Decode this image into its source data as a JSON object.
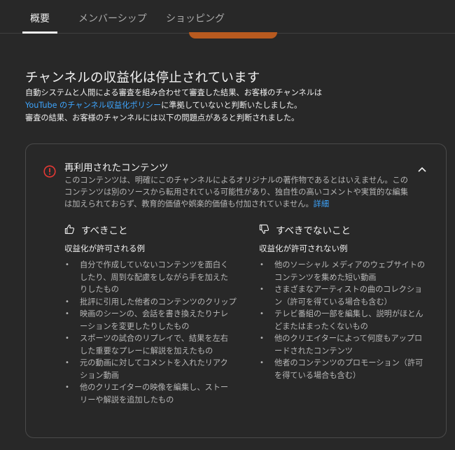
{
  "tabs": [
    {
      "label": "概要",
      "active": true
    },
    {
      "label": "メンバーシップ",
      "active": false
    },
    {
      "label": "ショッピング",
      "active": false
    }
  ],
  "heading": "チャンネルの収益化は停止されています",
  "intro": {
    "line1": "自動システムと人間による審査を組み合わせて審査した結果、お客様のチャンネルは",
    "policy_link": "YouTube のチャンネル収益化ポリシー",
    "line2_rest": "に準拠していないと判断いたしました。",
    "line3": "審査の結果、お客様のチャンネルには以下の問題点があると判断されました。"
  },
  "issue": {
    "title": "再利用されたコンテンツ",
    "desc_lines": [
      "このコンテンツは、明確にこのチャンネルによるオリジナルの著作物であるとはいえません。この",
      "コンテンツは別のソースから転用されている可能性があり、独自性の高いコメントや実質的な編集",
      "は加えられておらず、教育的価値や娯楽的価値も付加されていません。"
    ],
    "more_link": "詳細",
    "do": {
      "title": "すべきこと",
      "subtitle": "収益化が許可される例",
      "items": [
        [
          "自分で作成していないコンテンツを面白く",
          "したり、周到な配慮をしながら手を加えた",
          "りしたもの"
        ],
        [
          "批評に引用した他者のコンテンツのクリップ"
        ],
        [
          "映画のシーンの、会話を書き換えたりナレ",
          "ーションを変更したりしたもの"
        ],
        [
          "スポーツの試合のリプレイで、結果を左右",
          "した重要なプレーに解説を加えたもの"
        ],
        [
          "元の動画に対してコメントを入れたリアク",
          "ション動画"
        ],
        [
          "他のクリエイターの映像を編集し、ストー",
          "リーや解説を追加したもの"
        ]
      ]
    },
    "dont": {
      "title": "すべきでないこと",
      "subtitle": "収益化が許可されない例",
      "items": [
        [
          "他のソーシャル メディアのウェブサイトの",
          "コンテンツを集めた短い動画"
        ],
        [
          "さまざまなアーティストの曲のコレクショ",
          "ン（許可を得ている場合も含む）"
        ],
        [
          "テレビ番組の一部を編集し、説明がほとん",
          "どまたはまったくないもの"
        ],
        [
          "他のクリエイターによって何度もアップロ",
          "ードされたコンテンツ"
        ],
        [
          "他者のコンテンツのプロモーション（許可",
          "を得ている場合も含む）"
        ]
      ]
    }
  },
  "colors": {
    "background": "#282828",
    "link": "#3ea6ff",
    "alert": "#e53935",
    "accent_bar": "#b85a1f"
  },
  "icons": {
    "alert": "alert-circle-icon",
    "collapse": "chevron-up-icon",
    "thumbs_up": "thumbs-up-icon",
    "thumbs_down": "thumbs-down-icon"
  }
}
